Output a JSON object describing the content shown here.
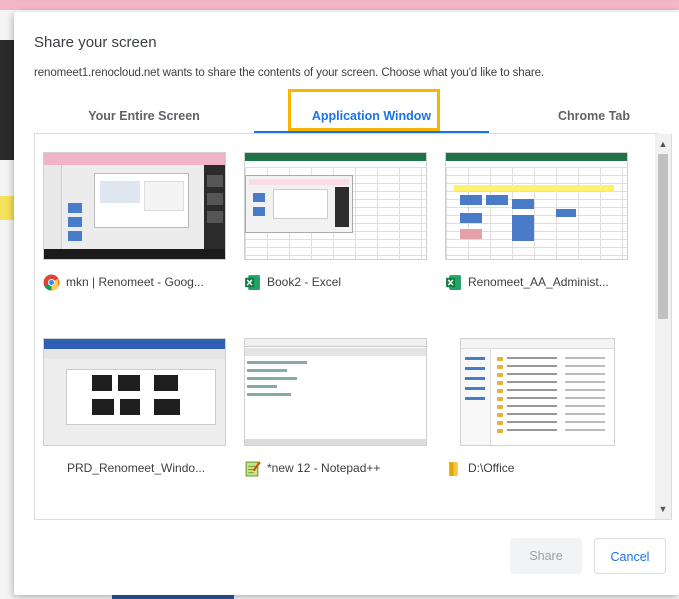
{
  "dialog": {
    "title": "Share your screen",
    "subtitle": "renomeet1.renocloud.net wants to share the contents of your screen. Choose what you'd like to share."
  },
  "tabs": [
    {
      "label": "Your Entire Screen",
      "selected": false
    },
    {
      "label": "Application Window",
      "selected": true
    },
    {
      "label": "Chrome Tab",
      "selected": false
    }
  ],
  "windows": [
    {
      "label": "mkn | Renomeet - Goog...",
      "icon": "chrome-icon"
    },
    {
      "label": "Book2 - Excel",
      "icon": "excel-icon"
    },
    {
      "label": "Renomeet_AA_Administ...",
      "icon": "excel-icon"
    },
    {
      "label": "PRD_Renomeet_Windo...",
      "icon": "none"
    },
    {
      "label": "*new 12 - Notepad++",
      "icon": "notepad-plus-plus-icon"
    },
    {
      "label": "D:\\Office",
      "icon": "folder-icon"
    }
  ],
  "buttons": {
    "share": "Share",
    "cancel": "Cancel"
  },
  "colors": {
    "accent": "#1a73e8",
    "highlight": "#f7b500",
    "excel_green": "#217346"
  }
}
